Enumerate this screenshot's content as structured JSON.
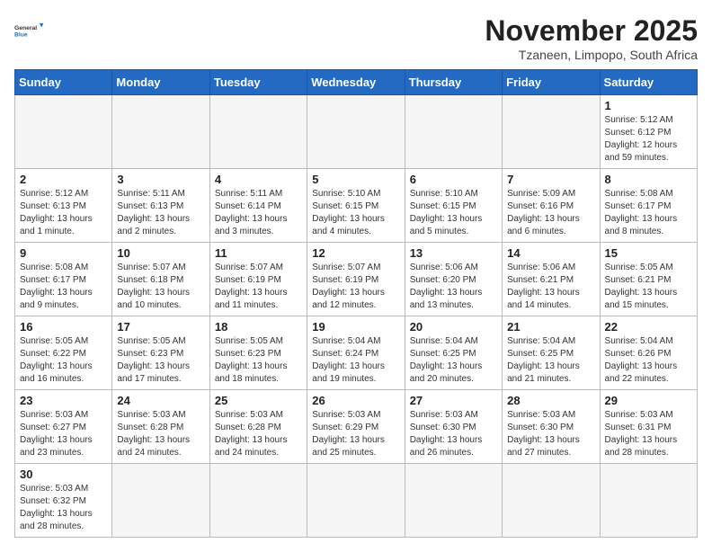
{
  "header": {
    "logo_general": "General",
    "logo_blue": "Blue",
    "month_title": "November 2025",
    "location": "Tzaneen, Limpopo, South Africa"
  },
  "weekdays": [
    "Sunday",
    "Monday",
    "Tuesday",
    "Wednesday",
    "Thursday",
    "Friday",
    "Saturday"
  ],
  "days": {
    "d1": {
      "num": "1",
      "info": "Sunrise: 5:12 AM\nSunset: 6:12 PM\nDaylight: 12 hours\nand 59 minutes."
    },
    "d2": {
      "num": "2",
      "info": "Sunrise: 5:12 AM\nSunset: 6:13 PM\nDaylight: 13 hours\nand 1 minute."
    },
    "d3": {
      "num": "3",
      "info": "Sunrise: 5:11 AM\nSunset: 6:13 PM\nDaylight: 13 hours\nand 2 minutes."
    },
    "d4": {
      "num": "4",
      "info": "Sunrise: 5:11 AM\nSunset: 6:14 PM\nDaylight: 13 hours\nand 3 minutes."
    },
    "d5": {
      "num": "5",
      "info": "Sunrise: 5:10 AM\nSunset: 6:15 PM\nDaylight: 13 hours\nand 4 minutes."
    },
    "d6": {
      "num": "6",
      "info": "Sunrise: 5:10 AM\nSunset: 6:15 PM\nDaylight: 13 hours\nand 5 minutes."
    },
    "d7": {
      "num": "7",
      "info": "Sunrise: 5:09 AM\nSunset: 6:16 PM\nDaylight: 13 hours\nand 6 minutes."
    },
    "d8": {
      "num": "8",
      "info": "Sunrise: 5:08 AM\nSunset: 6:17 PM\nDaylight: 13 hours\nand 8 minutes."
    },
    "d9": {
      "num": "9",
      "info": "Sunrise: 5:08 AM\nSunset: 6:17 PM\nDaylight: 13 hours\nand 9 minutes."
    },
    "d10": {
      "num": "10",
      "info": "Sunrise: 5:07 AM\nSunset: 6:18 PM\nDaylight: 13 hours\nand 10 minutes."
    },
    "d11": {
      "num": "11",
      "info": "Sunrise: 5:07 AM\nSunset: 6:19 PM\nDaylight: 13 hours\nand 11 minutes."
    },
    "d12": {
      "num": "12",
      "info": "Sunrise: 5:07 AM\nSunset: 6:19 PM\nDaylight: 13 hours\nand 12 minutes."
    },
    "d13": {
      "num": "13",
      "info": "Sunrise: 5:06 AM\nSunset: 6:20 PM\nDaylight: 13 hours\nand 13 minutes."
    },
    "d14": {
      "num": "14",
      "info": "Sunrise: 5:06 AM\nSunset: 6:21 PM\nDaylight: 13 hours\nand 14 minutes."
    },
    "d15": {
      "num": "15",
      "info": "Sunrise: 5:05 AM\nSunset: 6:21 PM\nDaylight: 13 hours\nand 15 minutes."
    },
    "d16": {
      "num": "16",
      "info": "Sunrise: 5:05 AM\nSunset: 6:22 PM\nDaylight: 13 hours\nand 16 minutes."
    },
    "d17": {
      "num": "17",
      "info": "Sunrise: 5:05 AM\nSunset: 6:23 PM\nDaylight: 13 hours\nand 17 minutes."
    },
    "d18": {
      "num": "18",
      "info": "Sunrise: 5:05 AM\nSunset: 6:23 PM\nDaylight: 13 hours\nand 18 minutes."
    },
    "d19": {
      "num": "19",
      "info": "Sunrise: 5:04 AM\nSunset: 6:24 PM\nDaylight: 13 hours\nand 19 minutes."
    },
    "d20": {
      "num": "20",
      "info": "Sunrise: 5:04 AM\nSunset: 6:25 PM\nDaylight: 13 hours\nand 20 minutes."
    },
    "d21": {
      "num": "21",
      "info": "Sunrise: 5:04 AM\nSunset: 6:25 PM\nDaylight: 13 hours\nand 21 minutes."
    },
    "d22": {
      "num": "22",
      "info": "Sunrise: 5:04 AM\nSunset: 6:26 PM\nDaylight: 13 hours\nand 22 minutes."
    },
    "d23": {
      "num": "23",
      "info": "Sunrise: 5:03 AM\nSunset: 6:27 PM\nDaylight: 13 hours\nand 23 minutes."
    },
    "d24": {
      "num": "24",
      "info": "Sunrise: 5:03 AM\nSunset: 6:28 PM\nDaylight: 13 hours\nand 24 minutes."
    },
    "d25": {
      "num": "25",
      "info": "Sunrise: 5:03 AM\nSunset: 6:28 PM\nDaylight: 13 hours\nand 24 minutes."
    },
    "d26": {
      "num": "26",
      "info": "Sunrise: 5:03 AM\nSunset: 6:29 PM\nDaylight: 13 hours\nand 25 minutes."
    },
    "d27": {
      "num": "27",
      "info": "Sunrise: 5:03 AM\nSunset: 6:30 PM\nDaylight: 13 hours\nand 26 minutes."
    },
    "d28": {
      "num": "28",
      "info": "Sunrise: 5:03 AM\nSunset: 6:30 PM\nDaylight: 13 hours\nand 27 minutes."
    },
    "d29": {
      "num": "29",
      "info": "Sunrise: 5:03 AM\nSunset: 6:31 PM\nDaylight: 13 hours\nand 28 minutes."
    },
    "d30": {
      "num": "30",
      "info": "Sunrise: 5:03 AM\nSunset: 6:32 PM\nDaylight: 13 hours\nand 28 minutes."
    }
  }
}
